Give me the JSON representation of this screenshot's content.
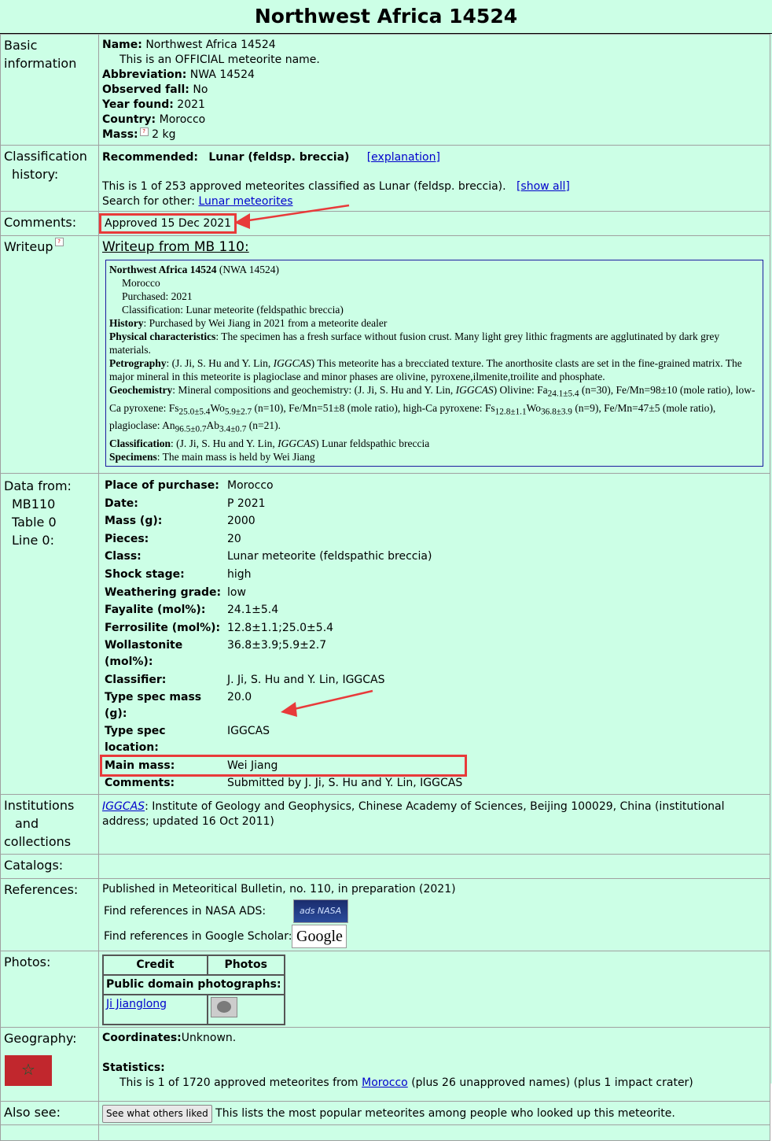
{
  "title": "Northwest Africa 14524",
  "basic": {
    "label": "Basic information",
    "name_label": "Name:",
    "name": "Northwest Africa 14524",
    "official": "This is an OFFICIAL meteorite name.",
    "abbr_label": "Abbreviation:",
    "abbr": "NWA 14524",
    "fall_label": "Observed fall:",
    "fall": "No",
    "year_label": "Year found:",
    "year": "2021",
    "country_label": "Country:",
    "country": "Morocco",
    "mass_label": "Mass:",
    "mass": "2 kg"
  },
  "classification": {
    "label_1": "Classification",
    "label_2": "history:",
    "recommended_label": "Recommended:",
    "recommended": "Lunar (feldsp. breccia)",
    "explanation_link": "[explanation]",
    "count_text": "This is 1 of 253 approved meteorites classified as Lunar (feldsp. breccia).",
    "show_all_link": "[show all]",
    "other_text": "Search for other:",
    "other_link": "Lunar meteorites"
  },
  "comments": {
    "label": "Comments:",
    "value": "Approved 15 Dec 2021"
  },
  "writeup": {
    "label": "Writeup",
    "link": "Writeup from MB 110:",
    "name": "Northwest Africa 14524",
    "abbr": "(NWA 14524)",
    "country": "Morocco",
    "purchased": "Purchased: 2021",
    "classification": "Classification: Lunar meteorite (feldspathic breccia)",
    "history_label": "History",
    "history": ": Purchased by Wei Jiang in 2021 from a meteorite dealer",
    "phys_label": "Physical characteristics",
    "phys": ": The specimen has a fresh surface without fusion crust. Many light grey lithic fragments are agglutinated by dark grey materials.",
    "petro_label": "Petrography",
    "petro_a": ": (J. Ji, S. Hu and Y. Lin, ",
    "petro_inst": "IGGCAS",
    "petro_b": ") This meteorite has a brecciated texture. The anorthosite clasts are set in the fine-grained matrix. The major mineral in this meteorite is plagioclase and minor phases are olivine, pyroxene,ilmenite,troilite and phosphate.",
    "geo_label": "Geochemistry",
    "geo_a": ": Mineral compositions and geochemistry: (J. Ji, S. Hu and Y. Lin, ",
    "geo_inst": "IGGCAS",
    "geo_b": ") Olivine: Fa",
    "geo_fa_sub": "24.1±5.4",
    "geo_c": " (n=30), Fe/Mn=98±10 (mole ratio), low-Ca pyroxene: Fs",
    "geo_fs1_sub": "25.0±5.4",
    "geo_wo": "Wo",
    "geo_wo1_sub": "5.9±2.7",
    "geo_d": " (n=10), Fe/Mn=51±8 (mole ratio), high-Ca pyroxene: Fs",
    "geo_fs2_sub": "12.8±1.1",
    "geo_wo2_sub": "36.8±3.9",
    "geo_e": " (n=9), Fe/Mn=47±5 (mole ratio), plagioclase: An",
    "geo_an_sub": "96.5±0.7",
    "geo_ab": "Ab",
    "geo_ab_sub": "3.4±0.7",
    "geo_f": " (n=21).",
    "class_label": "Classification",
    "class_a": ": (J. Ji, S. Hu and Y. Lin, ",
    "class_inst": "IGGCAS",
    "class_b": ") Lunar feldspathic breccia",
    "spec_label": "Specimens",
    "spec": ": The main mass is held by Wei Jiang"
  },
  "data_from": {
    "label_1": "Data from:",
    "label_2": "MB110",
    "label_3": "Table 0",
    "label_4": "Line 0:",
    "rows": [
      {
        "k": "Place of purchase:",
        "v": "Morocco"
      },
      {
        "k": "Date:",
        "v": "P 2021"
      },
      {
        "k": "Mass (g):",
        "v": "2000"
      },
      {
        "k": "Pieces:",
        "v": "20"
      },
      {
        "k": "Class:",
        "v": "Lunar meteorite (feldspathic breccia)"
      },
      {
        "k": "Shock stage:",
        "v": "high"
      },
      {
        "k": "Weathering grade:",
        "v": "low"
      },
      {
        "k": "Fayalite (mol%):",
        "v": "24.1±5.4"
      },
      {
        "k": "Ferrosilite (mol%):",
        "v": "12.8±1.1;25.0±5.4"
      },
      {
        "k": "Wollastonite (mol%):",
        "v": "36.8±3.9;5.9±2.7"
      },
      {
        "k": "Classifier:",
        "v": "J. Ji, S. Hu and Y. Lin, IGGCAS"
      },
      {
        "k": "Type spec mass (g):",
        "v": "20.0"
      },
      {
        "k": "Type spec location:",
        "v": "IGGCAS"
      },
      {
        "k": "Main mass:",
        "v": "Wei Jiang"
      },
      {
        "k": "Comments:",
        "v": "Submitted by J. Ji, S. Hu and Y. Lin, IGGCAS"
      }
    ]
  },
  "institutions": {
    "label_1": "Institutions",
    "label_2": "and",
    "label_3": "collections",
    "link": "IGGCAS",
    "text": ": Institute of Geology and Geophysics, Chinese Academy of Sciences, Beijing 100029, China (institutional address; updated 16 Oct 2011)"
  },
  "catalogs": {
    "label": "Catalogs:"
  },
  "references": {
    "label": "References:",
    "published": "Published in Meteoritical Bulletin, no. 110, in preparation (2021)",
    "nasa_text": "Find references in NASA ADS:",
    "nasa_btn": "ads NASA",
    "google_text": "Find references in Google Scholar:",
    "google_btn": "Google"
  },
  "photos": {
    "label": "Photos:",
    "col_credit": "Credit",
    "col_photos": "Photos",
    "public": "Public domain photographs:",
    "credit_link": "Ji Jianglong"
  },
  "geography": {
    "label": "Geography:",
    "coord_label": "Coordinates:",
    "coord": "Unknown.",
    "stats_label": "Statistics:",
    "stats_a": "This is 1 of 1720 approved meteorites from ",
    "stats_link": "Morocco",
    "stats_b": " (plus 26 unapproved names) (plus 1 impact crater)"
  },
  "also_see": {
    "label": "Also see:",
    "button": "See what others liked",
    "text": "This lists the most popular meteorites among people who looked up this meteorite."
  },
  "colors": {
    "background": "#ccffe6",
    "highlight": "#e83a3a",
    "link": "#0000cc",
    "writeup_border": "#1b1ba0"
  }
}
